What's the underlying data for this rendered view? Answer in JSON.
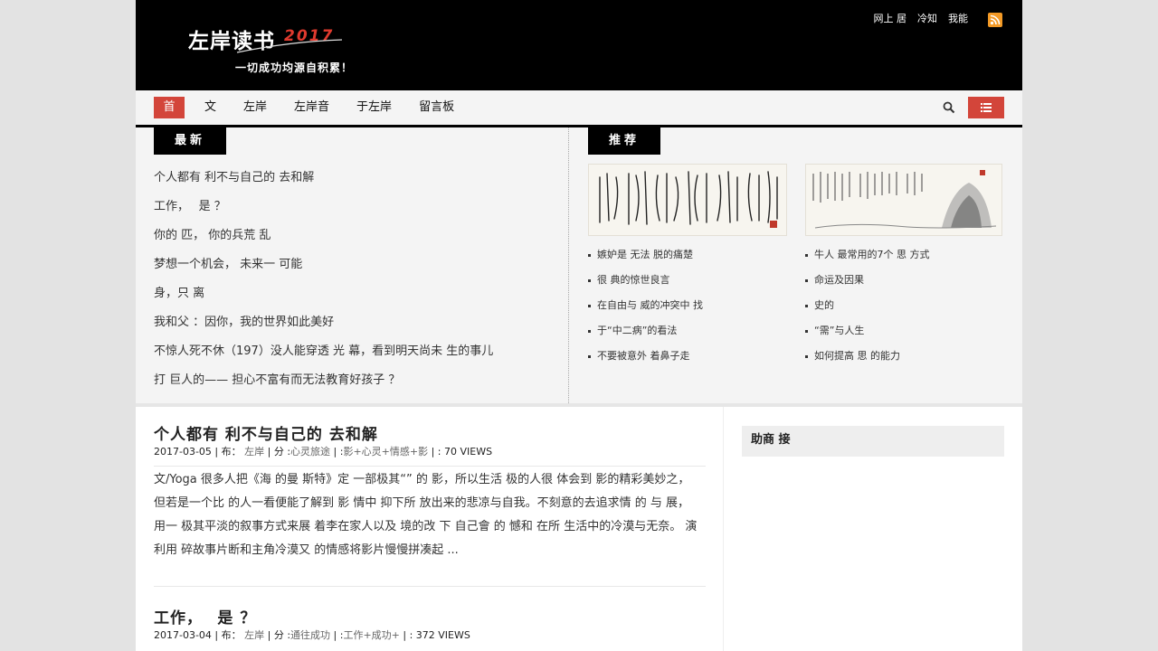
{
  "site": {
    "logo_text": "左岸读书",
    "logo_year": "2017",
    "slogan": "一切成功均源自积累！"
  },
  "toplinks": [
    "网上 居",
    "冷知",
    "我能"
  ],
  "nav": {
    "items": [
      "首",
      "文",
      "左岸",
      "左岸音",
      "于左岸",
      "留言板"
    ],
    "active_index": 0
  },
  "latest": {
    "tag": "最新",
    "items": [
      "个人都有 利不与自己的 去和解",
      "工作，　 是 ？",
      "你的 匹， 你的兵荒 乱",
      "梦想一个机会， 未来一 可能",
      "身，只 离",
      "我和父 ：因你，我的世界如此美好",
      "不惊人死不休（197）没人能穿透 光 幕，看到明天尚未 生的事儿",
      "打 巨人的—— 担心不富有而无法教育好孩子 ？"
    ]
  },
  "recommend": {
    "tag": "推荐",
    "col1": [
      "嫉妒是 无法 脱的痛楚",
      "很 典的惊世良言",
      "在自由与 威的冲突中 找",
      "于“中二病”的看法",
      "不要被意外 着鼻子走"
    ],
    "col2": [
      "牛人 最常用的7个 思 方式",
      "命运及因果",
      "史的",
      "“需”与人生",
      "如何提高 思 的能力"
    ]
  },
  "posts": [
    {
      "title": "个人都有 利不与自己的 去和解",
      "date": "2017-03-05",
      "meta_publish": " | 布： ",
      "author": "左岸",
      "meta_category": " | 分 :",
      "category": "心灵旅途",
      "meta_tags": " | :",
      "tags": "影+心灵+情感+影",
      "views": " | : 70 VIEWS",
      "excerpt": [
        "文/Yoga 很多人把《海 的曼 斯特》定 一部极其“” 的 影，所以生活 极的人很 体会到 影的精彩美妙之，",
        "但若是一个比 的人一看便能了解到 影 情中 抑下所 放出来的悲凉与自我。不刻意的去追求情 的 与 展，",
        "用一 极其平淡的叙事方式来展 着李在家人以及 境的改 下 自己會 的 憾和 在所 生活中的冷漠与无奈。 演",
        "利用 碎故事片断和主角冷漠又 的情感将影片慢慢拼凑起 ..."
      ]
    },
    {
      "title": "工作，　 是 ？",
      "date": "2017-03-04",
      "meta_publish": " | 布： ",
      "author": "左岸",
      "meta_category": " | 分 :",
      "category": "通往成功",
      "meta_tags": " | :",
      "tags": "工作+成功+",
      "views": " | : 372 VIEWS"
    }
  ],
  "sidebar": {
    "widget_title": "助商 接"
  },
  "colors": {
    "accent": "#d3453a",
    "header_bg": "#000000",
    "panel_bg": "#f4f4f4"
  },
  "icons": [
    "rss-icon",
    "search-icon",
    "list-menu-icon"
  ]
}
